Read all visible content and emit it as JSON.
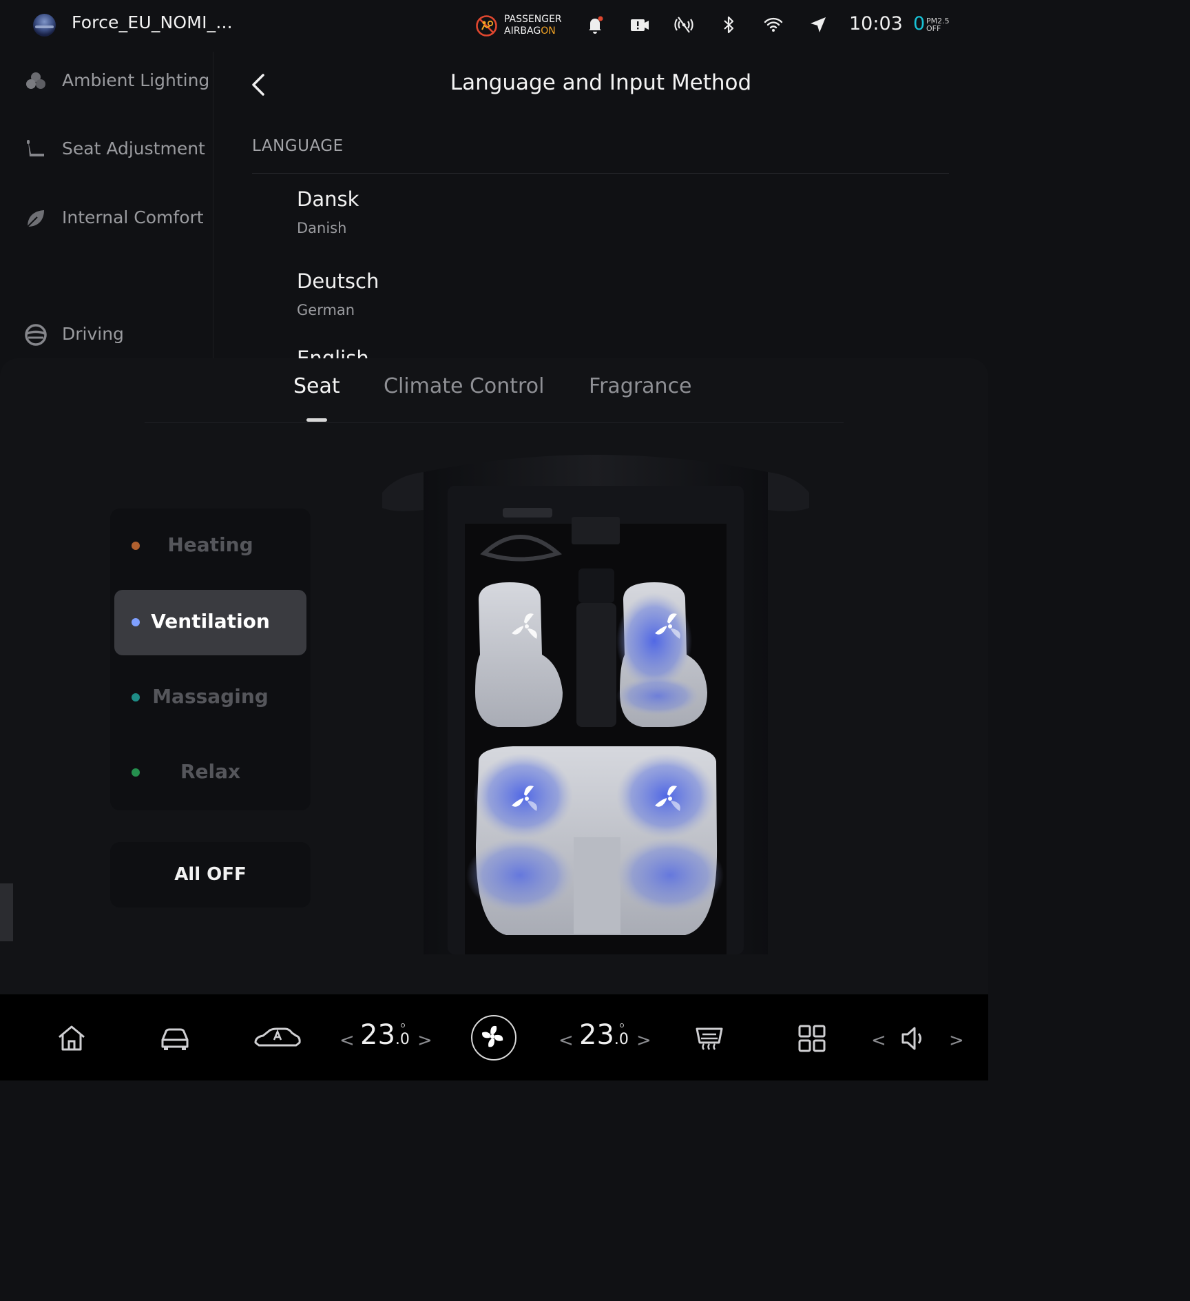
{
  "status_bar": {
    "profile_name": "Force_EU_NOMI_...",
    "airbag_line1": "PASSENGER",
    "airbag_line2_prefix": "AIRBAG",
    "airbag_line2_state": "ON",
    "time": "10:03",
    "pm_value": "0",
    "pm_label_top": "PM2.5",
    "pm_label_bottom": "OFF",
    "icons": [
      "airbag-off-icon",
      "notification-bell-icon",
      "dashcam-icon",
      "cellular-off-icon",
      "bluetooth-icon",
      "wifi-icon",
      "navigation-arrow-icon"
    ],
    "accent_color": "#18c2d6",
    "airbag_on_color": "#f5a524"
  },
  "sidebar": {
    "items": [
      {
        "label": "Ambient Lighting",
        "icon": "ambient-lighting-icon"
      },
      {
        "label": "Seat Adjustment",
        "icon": "seat-icon"
      },
      {
        "label": "Internal Comfort",
        "icon": "leaf-icon"
      },
      {
        "label": "Driving",
        "icon": "steering-wheel-icon"
      }
    ]
  },
  "settings": {
    "title": "Language and Input Method",
    "section_label": "LANGUAGE",
    "languages": [
      {
        "native": "Dansk",
        "english": "Danish"
      },
      {
        "native": "Deutsch",
        "english": "German"
      }
    ],
    "partial_item": "English"
  },
  "sheet": {
    "tabs": [
      {
        "label": "Seat",
        "active": true
      },
      {
        "label": "Climate Control",
        "active": false
      },
      {
        "label": "Fragrance",
        "active": false
      }
    ],
    "modes": [
      {
        "label": "Heating",
        "dot_color": "#b0602f",
        "selected": false
      },
      {
        "label": "Ventilation",
        "dot_color": "#7fa0ff",
        "selected": true
      },
      {
        "label": "Massaging",
        "dot_color": "#1e8c86",
        "selected": false
      },
      {
        "label": "Relax",
        "dot_color": "#25904e",
        "selected": false
      }
    ],
    "all_off_label": "All OFF",
    "seats": [
      {
        "position": "front-left",
        "ventilation_active": false
      },
      {
        "position": "front-right",
        "ventilation_active": true
      },
      {
        "position": "rear-left",
        "ventilation_active": true
      },
      {
        "position": "rear-right",
        "ventilation_active": true
      }
    ]
  },
  "dock": {
    "icons": [
      "home-icon",
      "car-icon",
      "auto-drive-icon",
      "fan-icon",
      "rear-defrost-icon",
      "apps-grid-icon",
      "volume-icon"
    ],
    "left_temp_whole": "23",
    "left_temp_decimal": ".0",
    "right_temp_whole": "23",
    "right_temp_decimal": ".0",
    "arrow_left": "<",
    "arrow_right": ">"
  }
}
